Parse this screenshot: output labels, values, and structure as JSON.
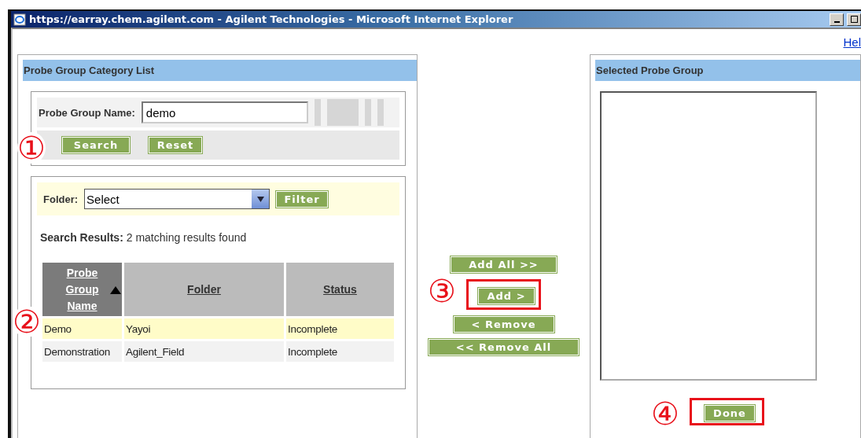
{
  "window": {
    "title": "https://earray.chem.agilent.com - Agilent Technologies - Microsoft Internet Explorer"
  },
  "help_link": "Hel",
  "category_panel": {
    "title": "Probe Group Category List",
    "name_label": "Probe Group Name:",
    "name_value": "demo",
    "annotation": "①",
    "buttons": [
      {
        "label": "Search"
      },
      {
        "label": "Reset"
      }
    ],
    "folder_label": "Folder:",
    "folder_value": "Select",
    "filter_button": "Filter",
    "results_label": "Search Results:",
    "results_text": "2 matching results found",
    "columns": [
      {
        "label": "Probe Group Name",
        "sorted": true
      },
      {
        "label": "Folder",
        "sorted": false
      },
      {
        "label": "Status",
        "sorted": false
      }
    ],
    "rows_annotation": "②",
    "rows": [
      {
        "cells": [
          "Demo",
          "Yayoi",
          "Incomplete"
        ],
        "highlighted": true
      },
      {
        "cells": [
          "Demonstration",
          "Agilent_Field",
          "Incomplete"
        ],
        "highlighted": false
      }
    ]
  },
  "transfer_buttons": [
    {
      "label": "Add All >>",
      "highlighted": false
    },
    {
      "label": "Add >",
      "highlighted": true,
      "annotation": "③"
    },
    {
      "label": "< Remove",
      "highlighted": false
    },
    {
      "label": "<< Remove All",
      "highlighted": false
    }
  ],
  "selected_panel": {
    "title": "Selected Probe Group",
    "done_button": {
      "label": "Done",
      "highlighted": true,
      "annotation": "④"
    }
  }
}
